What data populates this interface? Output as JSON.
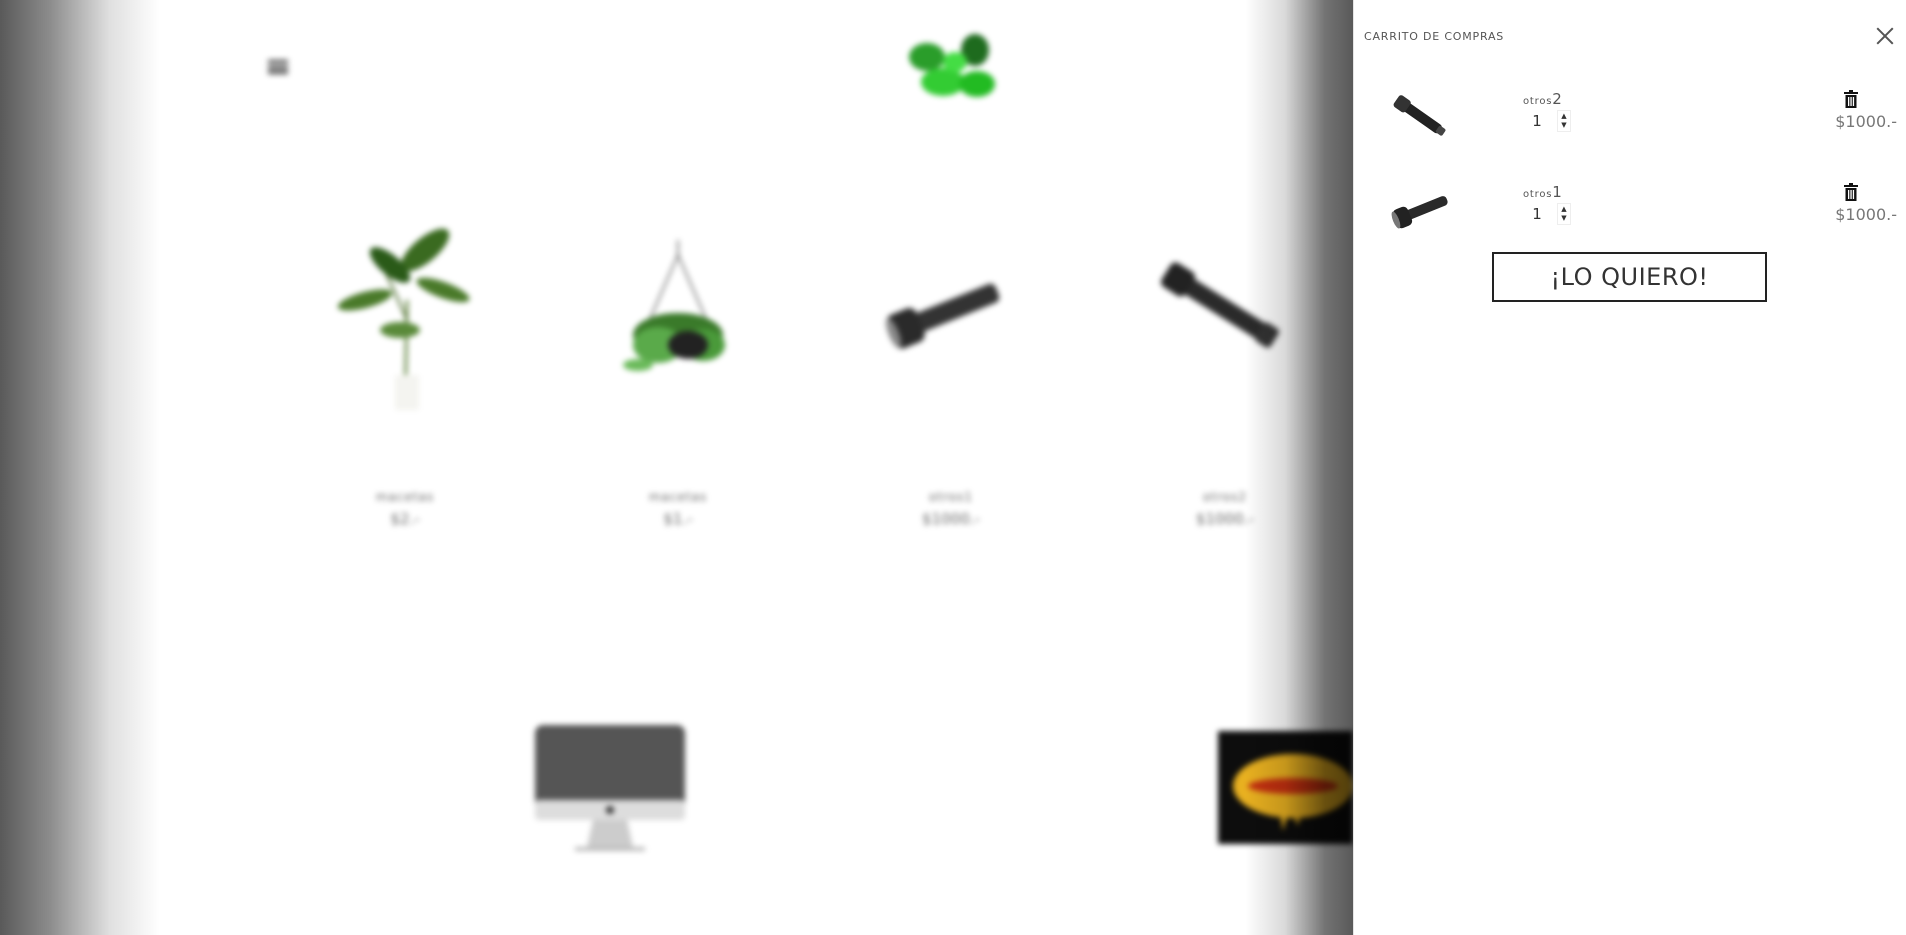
{
  "store": {
    "products": [
      {
        "name": "macetas",
        "price": "$2.-"
      },
      {
        "name": "macetas",
        "price": "$1.-"
      },
      {
        "name": "otros1",
        "price": "$1000.-"
      },
      {
        "name": "otros2",
        "price": "$1000.-"
      }
    ]
  },
  "cart": {
    "title": "CARRITO DE COMPRAS",
    "items": [
      {
        "name_prefix": "otros",
        "name_suffix": "2",
        "qty": "1",
        "price": "$1000.-"
      },
      {
        "name_prefix": "otros",
        "name_suffix": "1",
        "qty": "1",
        "price": "$1000.-"
      }
    ],
    "checkout_label": "¡LO QUIERO!"
  },
  "icons": {
    "menu": "hamburger-icon",
    "close": "close-icon",
    "delete": "trash-icon",
    "qty_up": "caret-up-icon",
    "qty_down": "caret-down-icon"
  },
  "colors": {
    "overlay": "#000000",
    "text": "#555555",
    "logo_green": "#22cc33"
  }
}
